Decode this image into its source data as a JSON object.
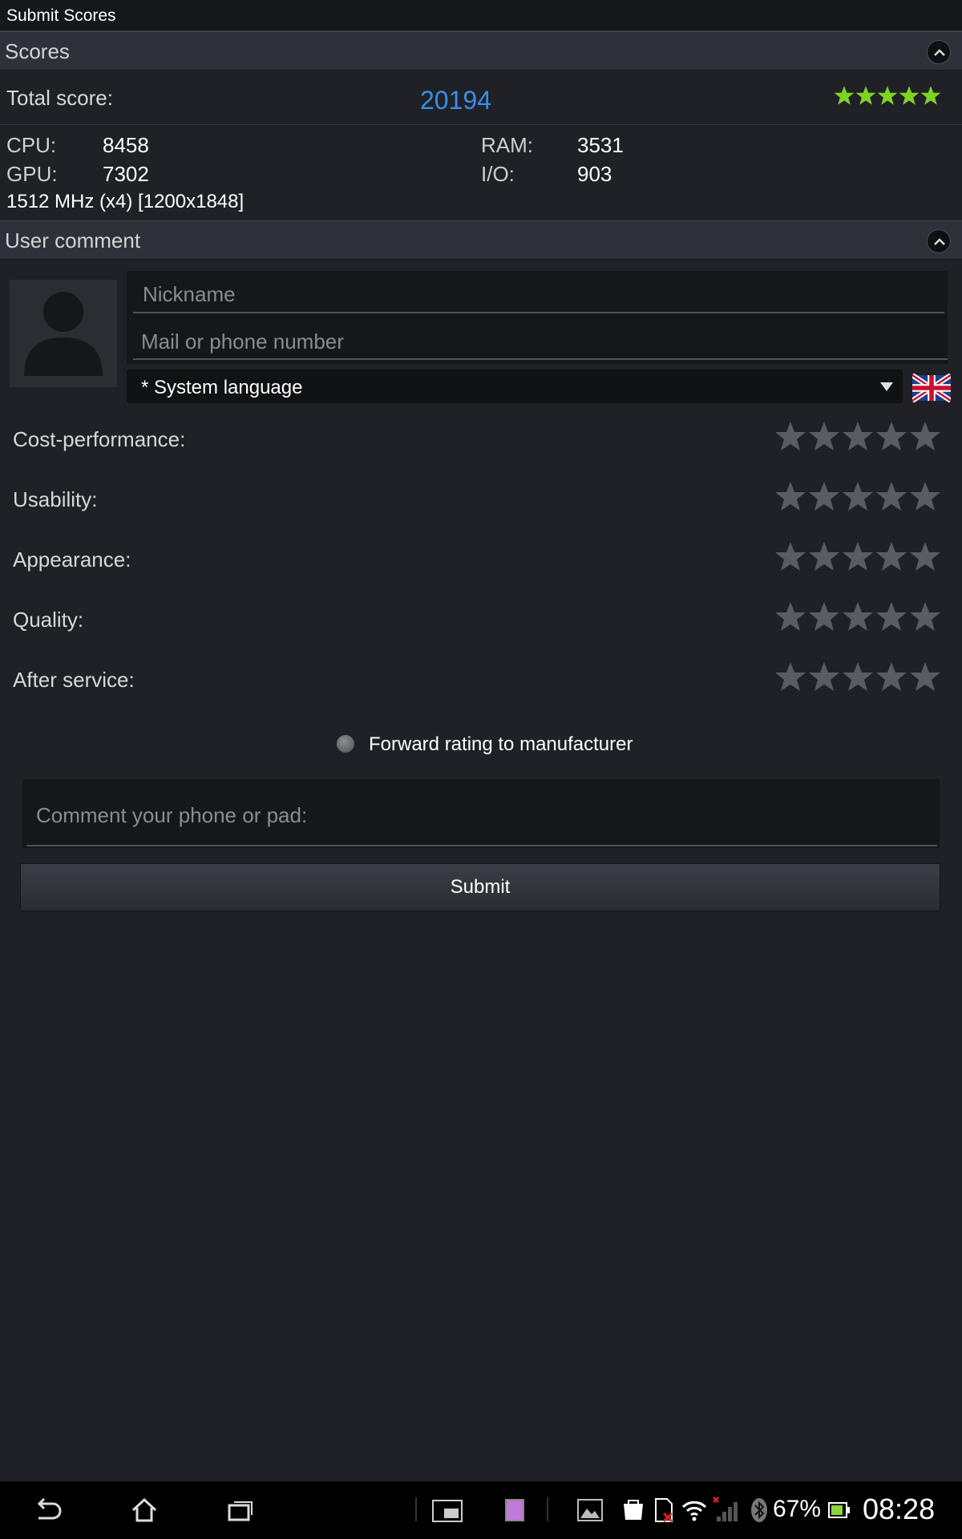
{
  "window": {
    "title": "Submit Scores"
  },
  "scores_section": {
    "header": "Scores",
    "total_label": "Total score:",
    "total_value": "20194",
    "total_stars": 5,
    "cpu_label": "CPU:",
    "cpu_value": "8458",
    "ram_label": "RAM:",
    "ram_value": "3531",
    "gpu_label": "GPU:",
    "gpu_value": "7302",
    "io_label": "I/O:",
    "io_value": "903",
    "device_info": "1512 MHz (x4) [1200x1848]"
  },
  "comment_section": {
    "header": "User comment",
    "nickname_placeholder": "Nickname",
    "contact_placeholder": "Mail or phone number",
    "language_value": "* System language",
    "ratings": [
      {
        "label": "Cost-performance:",
        "stars": 0
      },
      {
        "label": "Usability:",
        "stars": 0
      },
      {
        "label": "Appearance:",
        "stars": 0
      },
      {
        "label": "Quality:",
        "stars": 0
      },
      {
        "label": "After service:",
        "stars": 0
      }
    ],
    "forward_label": "Forward rating to manufacturer",
    "comment_placeholder": "Comment your phone or pad:",
    "submit_label": "Submit"
  },
  "status_bar": {
    "battery": "67%",
    "time": "08:28"
  },
  "colors": {
    "accent_blue": "#3a8ee6",
    "star_green": "#7ed321",
    "star_empty": "#5a5c61"
  }
}
